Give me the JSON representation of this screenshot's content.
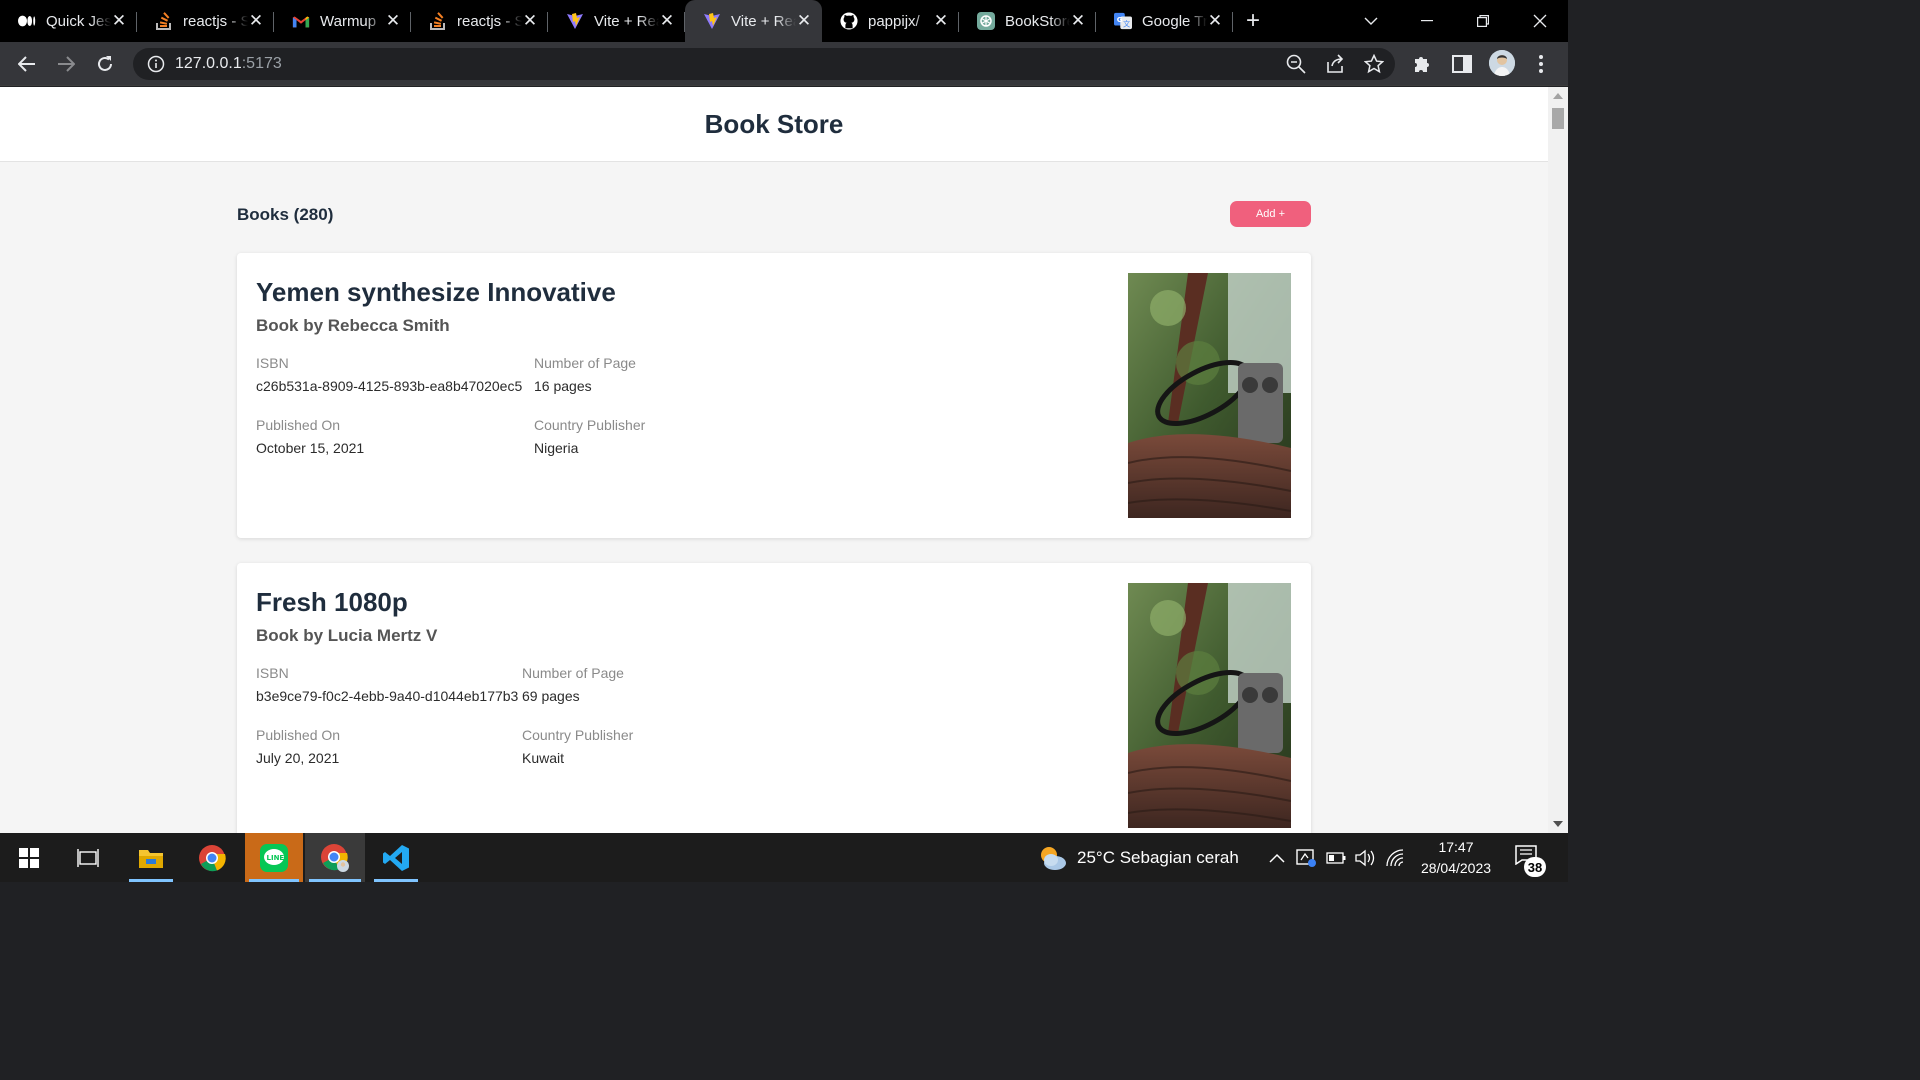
{
  "browser": {
    "tabs": [
      {
        "title": "Quick Jest",
        "icon": "medium-icon",
        "active": false
      },
      {
        "title": "reactjs - Stack",
        "icon": "stackoverflow-icon",
        "active": false
      },
      {
        "title": "Warmup",
        "icon": "gmail-icon",
        "active": false
      },
      {
        "title": "reactjs - Stack",
        "icon": "stackoverflow-icon",
        "active": false
      },
      {
        "title": "Vite + React",
        "icon": "vite-icon",
        "active": false
      },
      {
        "title": "Vite + React",
        "icon": "vite-icon",
        "active": true
      },
      {
        "title": "pappijx/",
        "icon": "github-icon",
        "active": false
      },
      {
        "title": "BookStore",
        "icon": "chatgpt-icon",
        "active": false
      },
      {
        "title": "Google Translate",
        "icon": "google-translate-icon",
        "active": false
      }
    ],
    "url_host": "127.0.0.1",
    "url_port": ":5173"
  },
  "app": {
    "title": "Book Store",
    "list_title": "Books (280)",
    "add_label": "Add +"
  },
  "labels": {
    "isbn": "ISBN",
    "pages": "Number of Page",
    "published": "Published On",
    "country": "Country Publisher"
  },
  "books": [
    {
      "name": "Yemen synthesize Innovative",
      "author": "Book by Rebecca Smith",
      "isbn": "c26b531a-8909-4125-893b-ea8b47020ec5",
      "pages": "16 pages",
      "published": "October 15, 2021",
      "country": "Nigeria"
    },
    {
      "name": "Fresh 1080p",
      "author": "Book by Lucia Mertz V",
      "isbn": "b3e9ce79-f0c2-4ebb-9a40-d1044eb177b3",
      "pages": "69 pages",
      "published": "July 20, 2021",
      "country": "Kuwait"
    }
  ],
  "taskbar": {
    "weather": "25°C  Sebagian cerah",
    "time": "17:47",
    "date": "28/04/2023",
    "notifications": "38"
  },
  "colors": {
    "accent": "#f0607d",
    "heading": "#1f2d3d"
  }
}
